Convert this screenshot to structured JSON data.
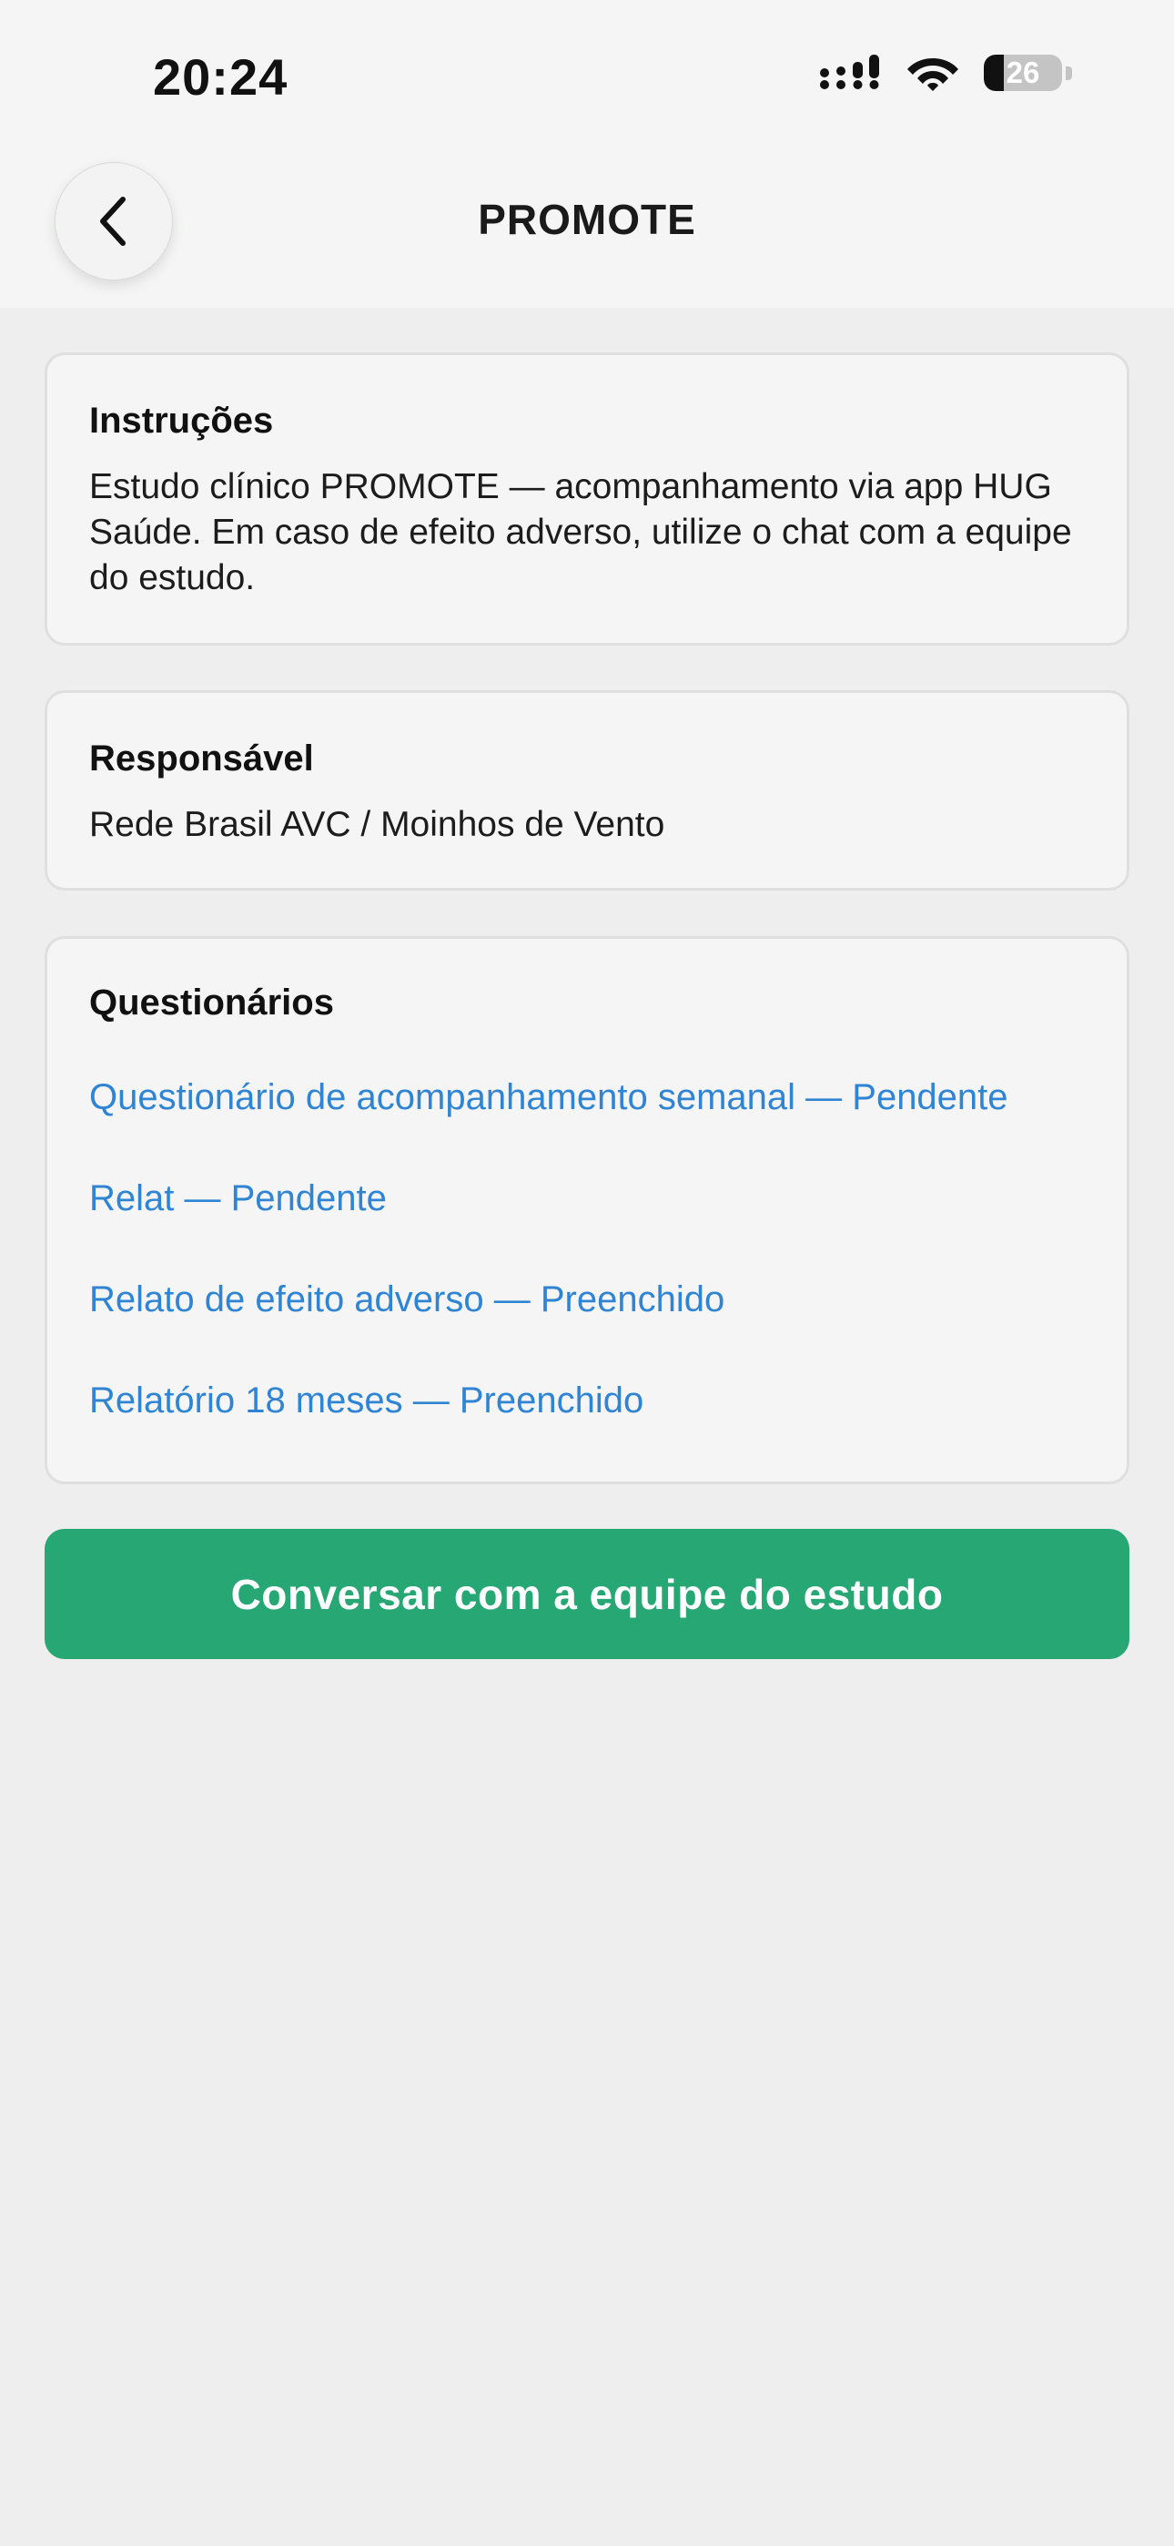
{
  "status_bar": {
    "time": "20:24",
    "battery_level": "26",
    "icons": [
      "cellular-signal-icon",
      "wifi-icon",
      "battery-icon"
    ]
  },
  "header": {
    "title": "PROMOTE",
    "back_icon": "chevron-left-icon"
  },
  "instructions": {
    "title": "Instruções",
    "text": "Estudo clínico PROMOTE — acompanhamento via app HUG Saúde. Em caso de efeito adverso, utilize o chat com a equipe do estudo."
  },
  "responsible": {
    "title": "Responsável",
    "text": "Rede Brasil AVC / Moinhos de Vento"
  },
  "questionnaires": {
    "title": "Questionários",
    "items": [
      {
        "label": "Questionário de acompanhamento semanal — Pendente"
      },
      {
        "label": "Relat — Pendente"
      },
      {
        "label": "Relato de efeito adverso — Preenchido"
      },
      {
        "label": "Relatório 18 meses — Preenchido"
      }
    ]
  },
  "chat_button": {
    "label": "Conversar com a equipe do estudo"
  },
  "colors": {
    "accent_green": "#27a774",
    "link_blue": "#2f84d3",
    "background": "#eeeeee",
    "card_background": "#f4f5f4"
  }
}
